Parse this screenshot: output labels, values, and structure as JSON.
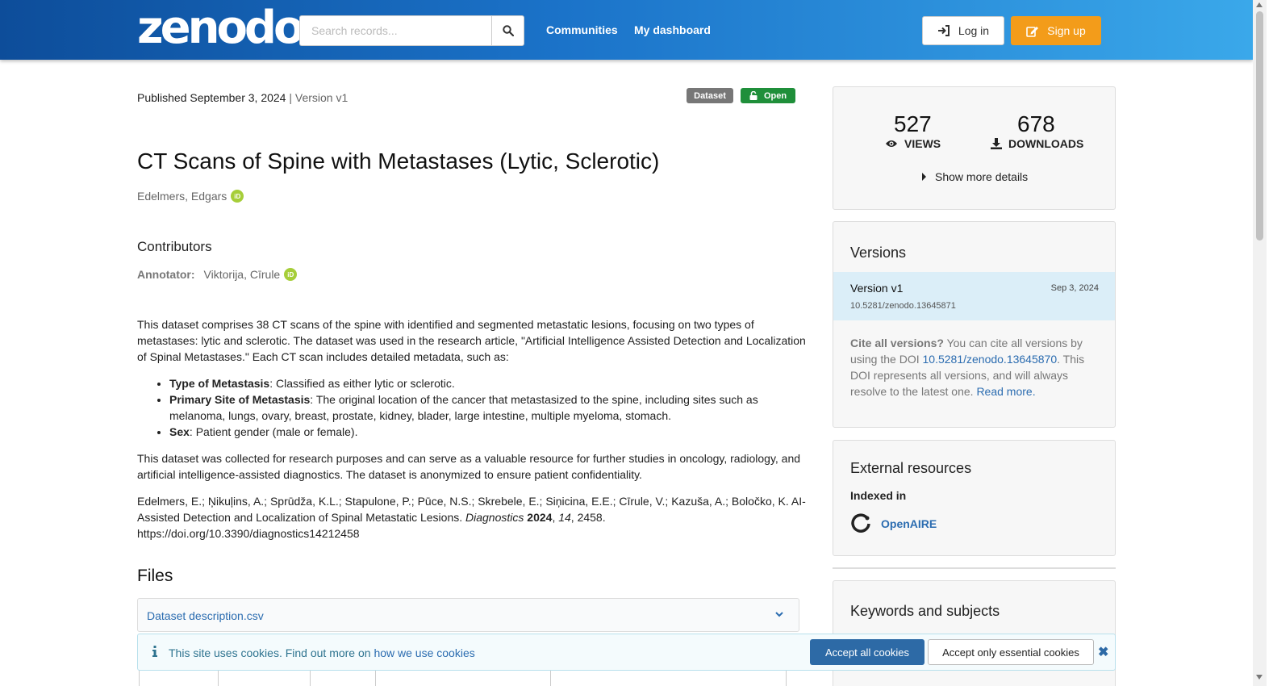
{
  "header": {
    "logo": "zenodo",
    "search_placeholder": "Search records...",
    "nav": [
      "Communities",
      "My dashboard"
    ],
    "login": "Log in",
    "signup": "Sign up"
  },
  "record": {
    "published": "Published September 3, 2024",
    "version": "Version v1",
    "badge_type": "Dataset",
    "badge_access": "Open",
    "title": "CT Scans of Spine with Metastases (Lytic, Sclerotic)",
    "author": "Edelmers, Edgars",
    "contributors_heading": "Contributors",
    "contributor_role": "Annotator:",
    "contributor_name": "Viktorija, Cīrule",
    "orcid_glyph": "iD",
    "description": {
      "p1": "This dataset comprises 38 CT scans of the spine with identified and segmented metastatic lesions, focusing on two types of metastases: lytic and sclerotic. The dataset was used in the research article, \"Artificial Intelligence Assisted Detection and Localization of Spinal Metastases.\" Each CT scan includes detailed metadata, such as:",
      "items": [
        {
          "term": "Type of Metastasis",
          "text": ": Classified as either lytic or sclerotic."
        },
        {
          "term": "Primary Site of Metastasis",
          "text": ": The original location of the cancer that metastasized to the spine, including sites such as melanoma, lungs, ovary, breast, prostate, kidney, blader, large intestine, multiple myeloma, stomach."
        },
        {
          "term": "Sex",
          "text": ": Patient gender (male or female)."
        }
      ],
      "p2": "This dataset was collected for research purposes and can serve as a valuable resource for further studies in oncology, radiology, and artificial intelligence-assisted diagnostics. The dataset is anonymized to ensure patient confidentiality.",
      "citation_start": "Edelmers, E.; Ņikuļins, A.; Sprūdža, K.L.; Stapulone, P.; Pūce, N.S.; Skrebele, E.; Siņicina, E.E.; Cīrule, V.; Kazuša, A.; Boločko, K. AI-Assisted Detection and Localization of Spinal Metastatic Lesions. ",
      "citation_journal": "Diagnostics",
      "citation_year": "2024",
      "citation_vol": "14",
      "citation_end": ", 2458. https://doi.org/10.3390/diagnostics14212458"
    },
    "files_heading": "Files",
    "file_name": "Dataset description.csv"
  },
  "stats": {
    "views": "527",
    "views_label": "VIEWS",
    "downloads": "678",
    "downloads_label": "DOWNLOADS",
    "more": "Show more details"
  },
  "versions": {
    "heading": "Versions",
    "name": "Version v1",
    "date": "Sep 3, 2024",
    "doi": "10.5281/zenodo.13645871",
    "cite_bold": "Cite all versions?",
    "cite_text1": " You can cite all versions by using the DOI ",
    "cite_doi": "10.5281/zenodo.13645870",
    "cite_text2": ". This DOI represents all versions, and will always resolve to the latest one. ",
    "read_more": "Read more."
  },
  "external": {
    "heading": "External resources",
    "indexed": "Indexed in",
    "openaire": "OpenAIRE"
  },
  "keywords": {
    "heading": "Keywords and subjects"
  },
  "cookie": {
    "text": "This site uses cookies. Find out more on ",
    "link": "how we use cookies",
    "accept_all": "Accept all cookies",
    "accept_essential": "Accept only essential cookies",
    "close": "✖"
  },
  "colors": {
    "header_start": "#0d4d9a",
    "header_end": "#3aa8ea",
    "signup": "#f39c1a",
    "open_badge": "#1f8f3a",
    "link": "#2b6cb0"
  }
}
